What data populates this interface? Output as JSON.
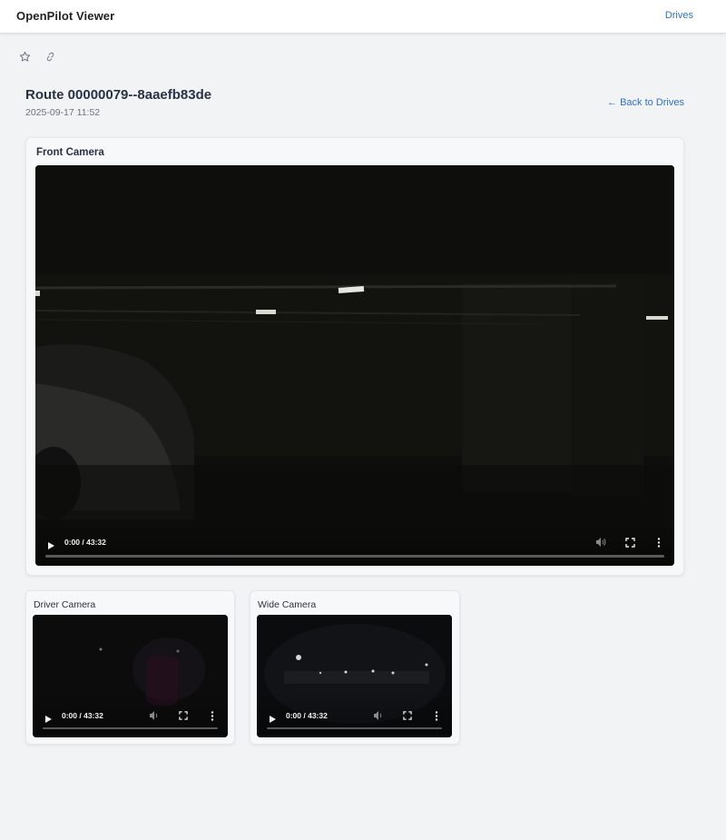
{
  "header": {
    "app_title": "OpenPilot Viewer",
    "nav_drives": "Drives"
  },
  "toolbar_icons": [
    "star-icon",
    "link-icon"
  ],
  "route": {
    "title": "Route 00000079--8aaefb83de",
    "date": "2025-09-17 11:52",
    "back_label": "← Back to Drives"
  },
  "cameras": {
    "front": {
      "title": "Front Camera",
      "time": "0:00 / 43:32"
    },
    "driver": {
      "title": "Driver Camera",
      "time": "0:00 / 43:32"
    },
    "wide": {
      "title": "Wide Camera",
      "time": "0:00 / 43:32"
    }
  },
  "colors": {
    "accent": "#2f6fc2",
    "background": "#f2f3f5",
    "video_bg": "#0d0e0c"
  }
}
